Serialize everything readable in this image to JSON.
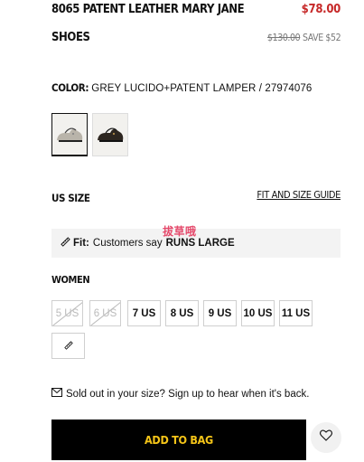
{
  "product": {
    "title_line1": "8065 PATENT LEATHER MARY JANE",
    "title_line2": "SHOES",
    "price": "$78.00",
    "original_price": "$130.00",
    "save_text": "SAVE $52"
  },
  "color": {
    "label": "COLOR:",
    "value": "GREY LUCIDO+PATENT LAMPER / 27974076",
    "swatches": [
      {
        "name": "grey-lucido",
        "selected": true
      },
      {
        "name": "black-patent",
        "selected": false
      }
    ]
  },
  "size": {
    "label": "US SIZE",
    "guide_link": "FIT AND SIZE GUIDE",
    "fit_label": "Fit:",
    "fit_text": "Customers say",
    "fit_value": "RUNS LARGE",
    "group_label": "WOMEN",
    "options": [
      {
        "label": "5 US",
        "available": false
      },
      {
        "label": "6 US",
        "available": false
      },
      {
        "label": "7 US",
        "available": true
      },
      {
        "label": "8 US",
        "available": true
      },
      {
        "label": "9 US",
        "available": true
      },
      {
        "label": "10 US",
        "available": true
      },
      {
        "label": "11 US",
        "available": true
      }
    ]
  },
  "watermark": "拔草哦",
  "soldout_text": "Sold out in your size? Sign up to hear when it's back.",
  "cta": {
    "add_to_bag": "ADD TO BAG"
  },
  "icons": {
    "fit": "ruler-icon",
    "measure": "ruler-icon",
    "soldout": "mail-icon",
    "wishlist": "heart-icon"
  },
  "colors": {
    "price": "#c62828",
    "cta_bg": "#000000",
    "cta_text": "#f5c518"
  }
}
